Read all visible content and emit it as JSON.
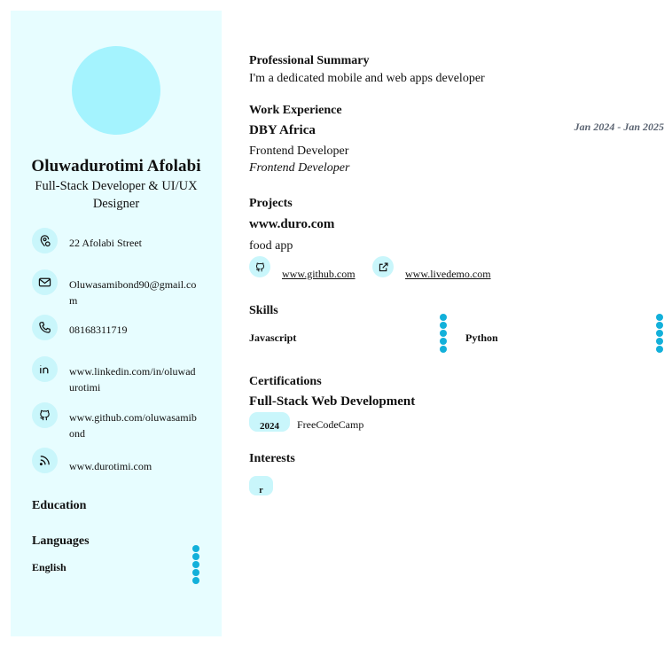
{
  "profile": {
    "name": "Oluwadurotimi Afolabi",
    "role": "Full-Stack Developer & UI/UX Designer"
  },
  "contacts": [
    {
      "icon": "location-icon",
      "text": "22 Afolabi Street"
    },
    {
      "icon": "mail-icon",
      "text": "Oluwasamibond90@gmail.com"
    },
    {
      "icon": "phone-icon",
      "text": "08168311719"
    },
    {
      "icon": "linkedin-icon",
      "text": "www.linkedin.com/in/oluwadurotimi"
    },
    {
      "icon": "github-icon",
      "text": "www.github.com/oluwasamibond"
    },
    {
      "icon": "rss-icon",
      "text": "www.durotimi.com"
    }
  ],
  "sidebar": {
    "education_heading": "Education",
    "languages_heading": "Languages",
    "languages": [
      {
        "name": "English",
        "level": 5
      }
    ]
  },
  "summary": {
    "heading": "Professional Summary",
    "text": "I'm a dedicated mobile and web apps developer"
  },
  "experience": {
    "heading": "Work Experience",
    "company": "DBY Africa",
    "dates": "Jan 2024 - Jan 2025",
    "title": "Frontend Developer",
    "subtitle": "Frontend Developer"
  },
  "projects": {
    "heading": "Projects",
    "name": "www.duro.com",
    "description": "food app",
    "github_link": "www.github.com",
    "demo_link": "www.livedemo.com"
  },
  "skills": {
    "heading": "Skills",
    "items": [
      {
        "name": "Javascript",
        "level": 5
      },
      {
        "name": "Python",
        "level": 5
      }
    ]
  },
  "certifications": {
    "heading": "Certifications",
    "name": "Full-Stack Web Development",
    "year": "2024",
    "issuer": "FreeCodeCamp"
  },
  "interests": {
    "heading": "Interests",
    "items": [
      "r"
    ]
  },
  "colors": {
    "sidebar_bg": "#e7fdff",
    "avatar": "#a4f3fe",
    "icon_bg": "#c9f6fb",
    "accent_dot": "#12b0da"
  }
}
